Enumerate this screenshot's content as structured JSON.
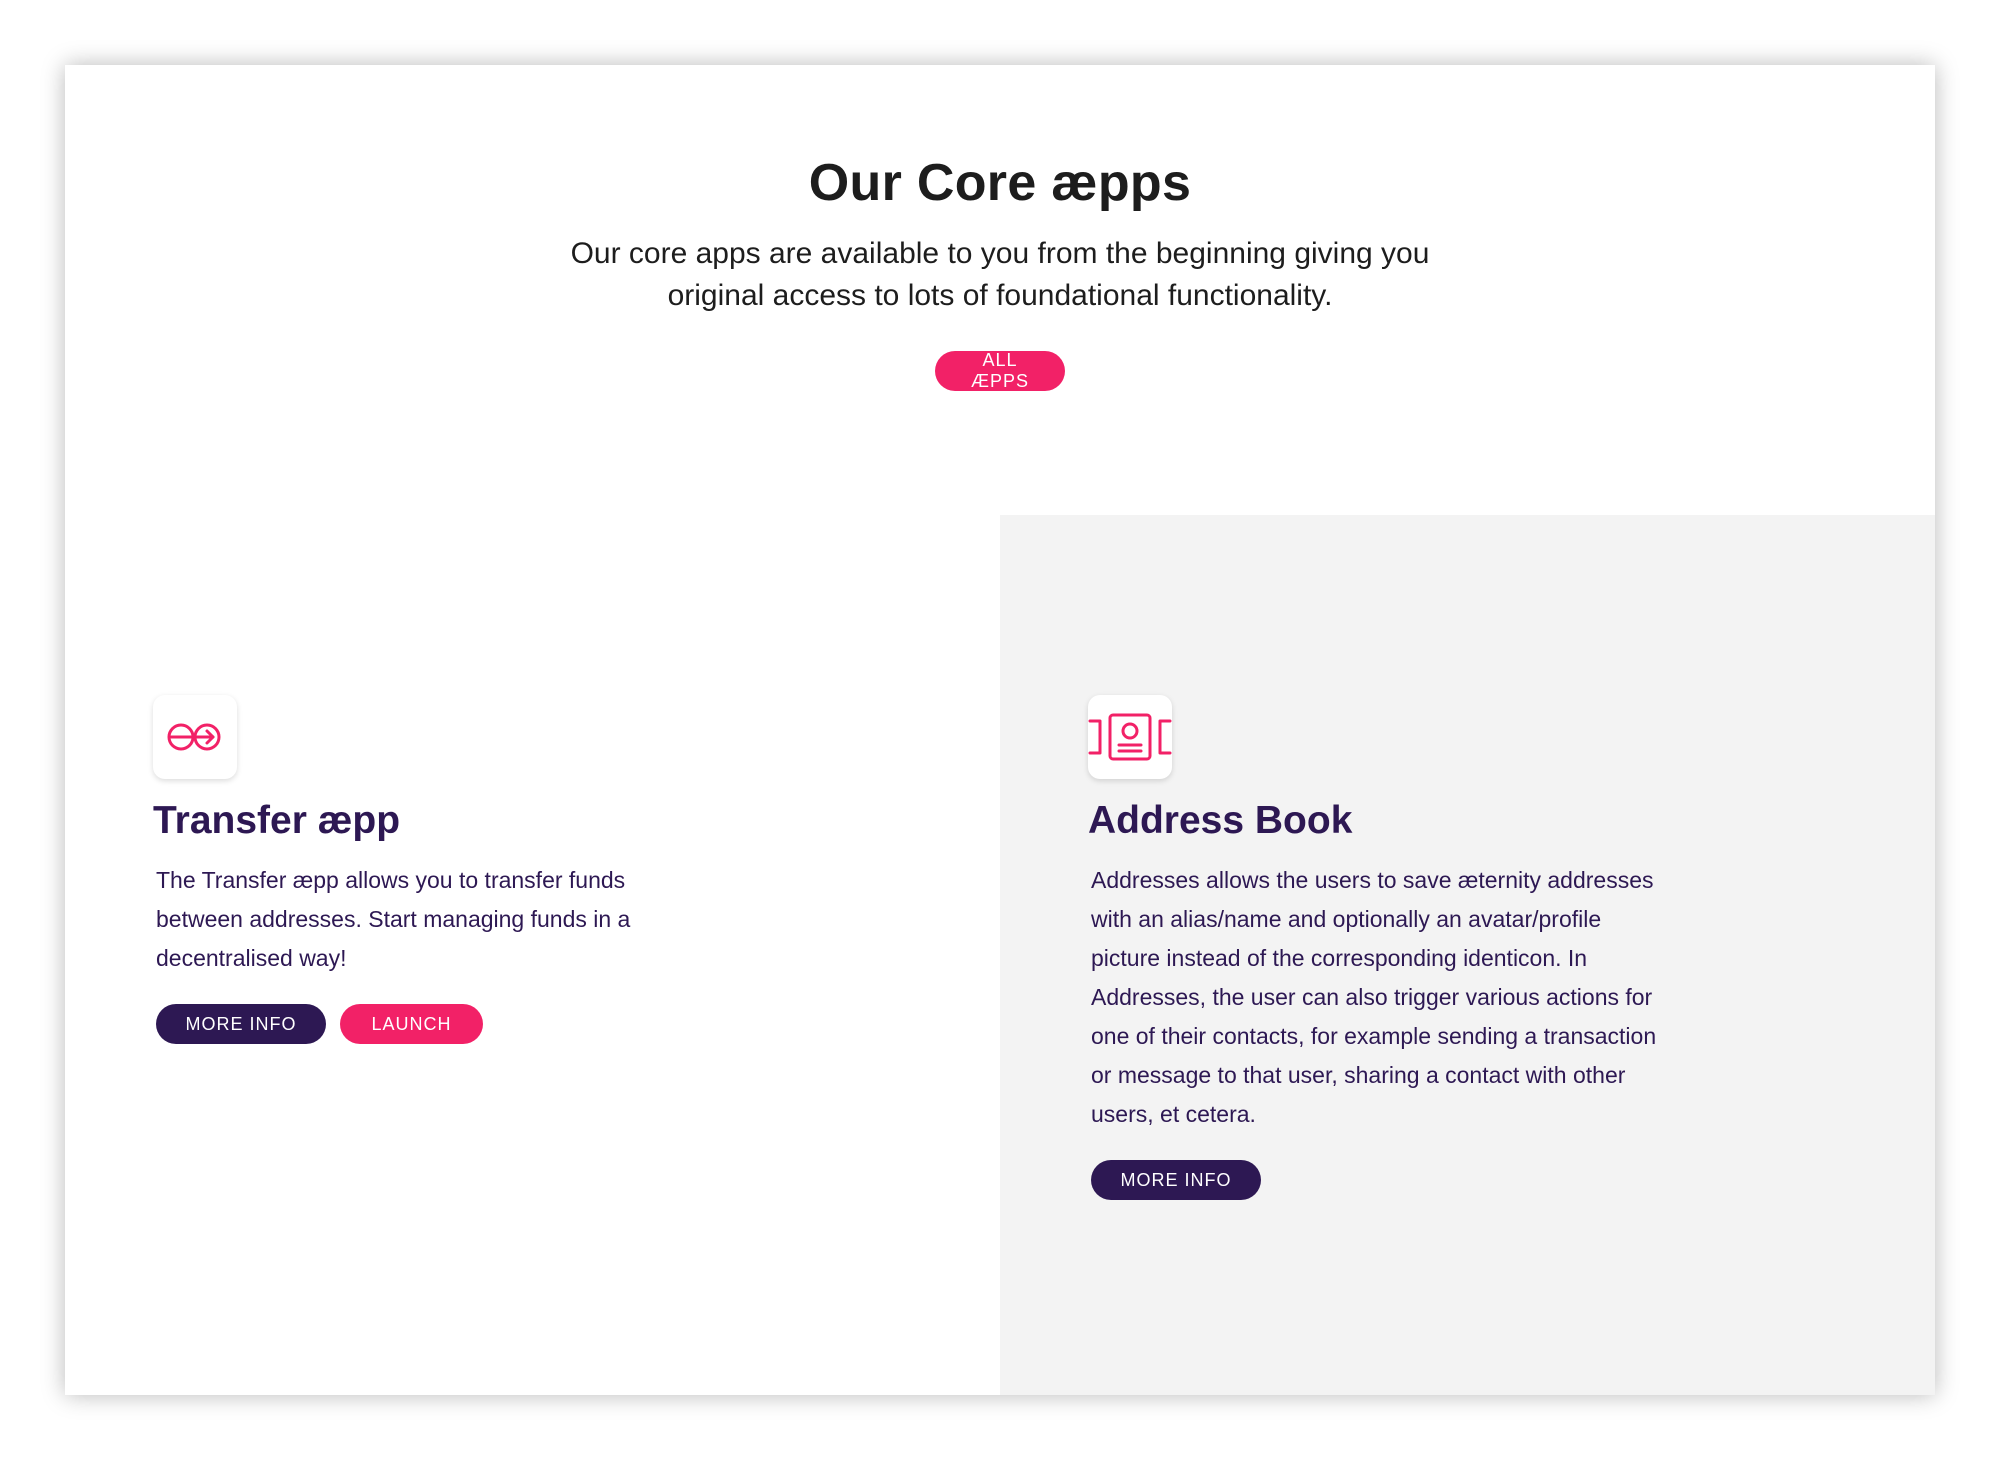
{
  "section": {
    "title": "Our Core æpps",
    "subtitle": "Our core apps are available to you from the beginning giving you original access to lots of foundational functionality.",
    "all_button": "ALL ÆPPS"
  },
  "features": [
    {
      "icon": "transfer-icon",
      "title": "Transfer æpp",
      "description": "The Transfer æpp allows you to transfer funds between addresses. Start managing funds in a decentralised way!",
      "more_button": "MORE INFO",
      "launch_button": "LAUNCH"
    },
    {
      "icon": "address-book-icon",
      "title": "Address Book",
      "description": "Addresses allows the users to save æternity addresses with an alias/name and optionally an avatar/profile picture instead of the corresponding identicon. In Addresses, the user can also trigger various actions for one of their contacts, for example sending a transaction or message to that user, sharing a contact with other users, et cetera.",
      "more_button": "MORE INFO"
    }
  ],
  "colors": {
    "accent_pink": "#f22167",
    "brand_navy": "#2d1853",
    "panel_gray": "#f3f3f3"
  }
}
